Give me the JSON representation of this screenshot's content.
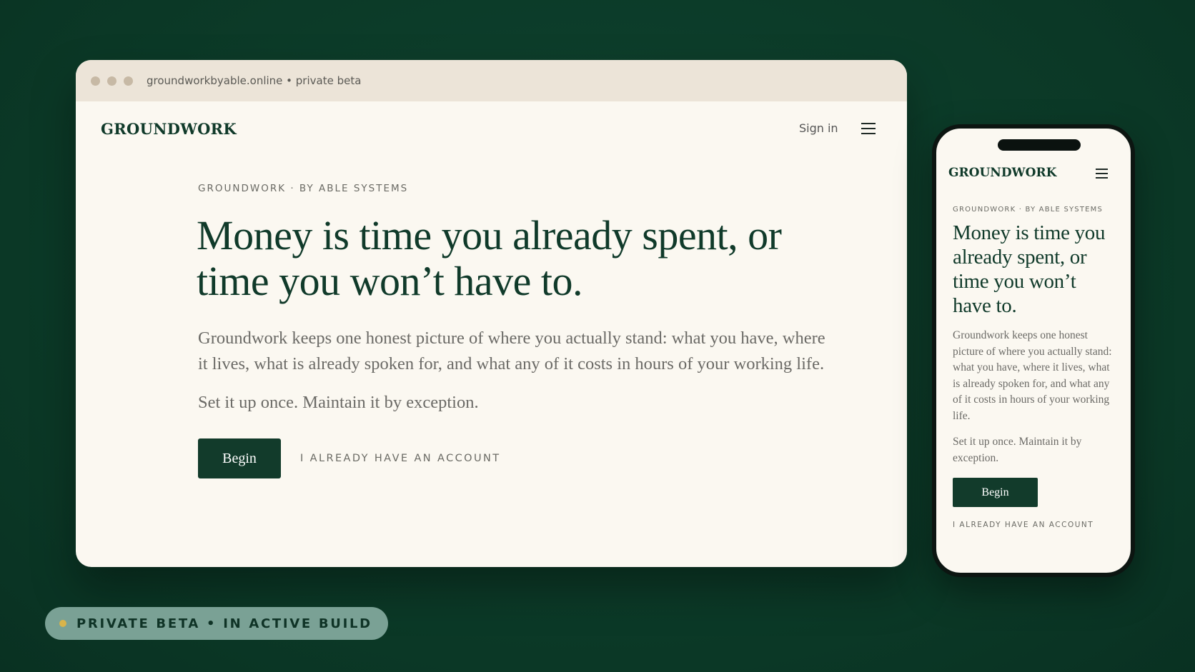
{
  "browser": {
    "url": "groundworkbyable.online • private beta"
  },
  "site": {
    "logo": "GROUNDWORK",
    "signin": "Sign in",
    "kicker": "GROUNDWORK · BY ABLE SYSTEMS",
    "headline": "Money is time you already spent, or time you won’t have to.",
    "lead": "Groundwork keeps one honest picture of where you actually stand: what you have, where it lives, what is already spoken for, and what any of it costs in hours of your working life.",
    "tagline": "Set it up once. Maintain it by exception.",
    "begin": "Begin",
    "account_link": "I ALREADY HAVE AN ACCOUNT"
  },
  "badge": {
    "text": "PRIVATE BETA • IN ACTIVE BUILD",
    "dot_color": "#d9b44a"
  },
  "colors": {
    "background": "#0d3d2b",
    "brand_green": "#123b2b",
    "page": "#fbf8f1"
  },
  "icons": [
    "menu-icon"
  ]
}
